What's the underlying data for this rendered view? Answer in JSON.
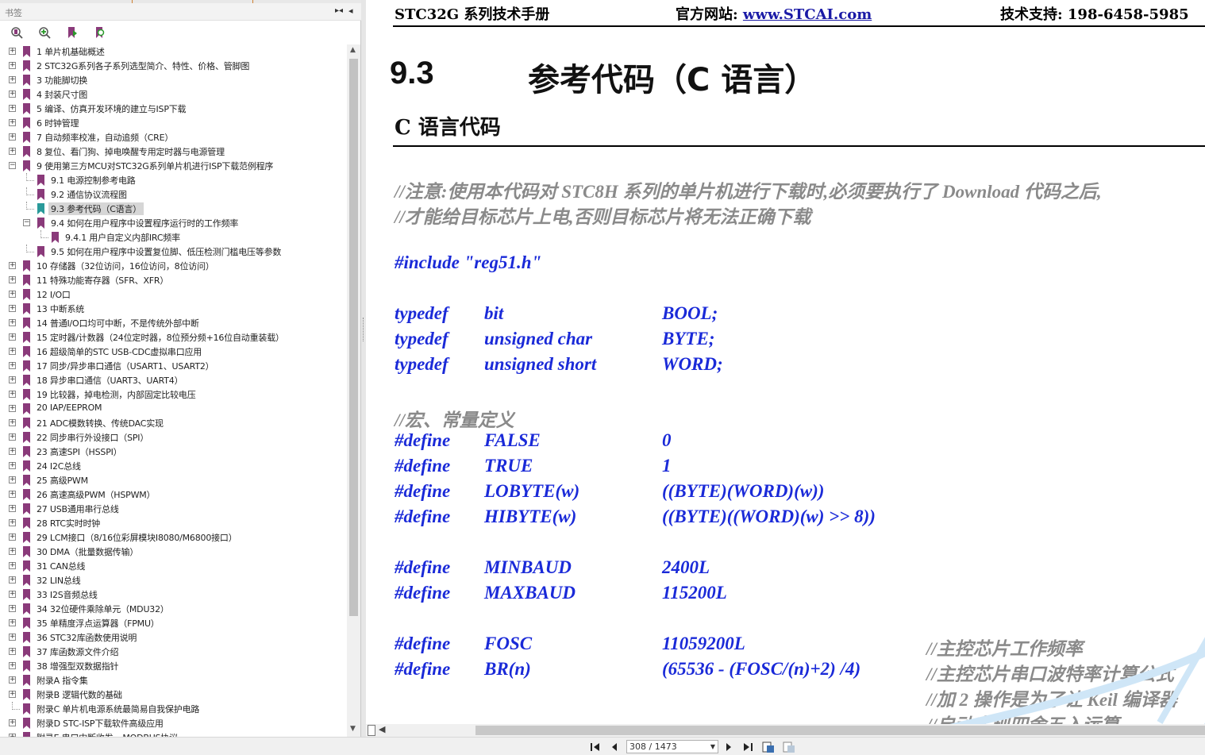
{
  "sidebar": {
    "title": "书签",
    "collapse_icon": "▸◂",
    "close_icon": "◂",
    "toolbar": [
      "expand-bookmark-icon",
      "add-bookmark-icon",
      "bookmark-up-icon",
      "bookmark-search-icon"
    ],
    "items": [
      {
        "label": "1 单片机基础概述",
        "level": 0,
        "expandable": true
      },
      {
        "label": "2  STC32G系列各子系列选型简介、特性、价格、管脚图",
        "level": 0,
        "expandable": true
      },
      {
        "label": "3  功能脚切换",
        "level": 0,
        "expandable": true
      },
      {
        "label": "4  封装尺寸图",
        "level": 0,
        "expandable": true
      },
      {
        "label": "5  编译、仿真开发环境的建立与ISP下载",
        "level": 0,
        "expandable": true
      },
      {
        "label": "6  时钟管理",
        "level": 0,
        "expandable": true
      },
      {
        "label": "7  自动频率校准，自动追频（CRE）",
        "level": 0,
        "expandable": true
      },
      {
        "label": "8  复位、看门狗、掉电唤醒专用定时器与电源管理",
        "level": 0,
        "expandable": true
      },
      {
        "label": "9  使用第三方MCU对STC32G系列单片机进行ISP下载范例程序",
        "level": 0,
        "expandable": true,
        "expanded": true
      },
      {
        "label": "9.1 电源控制参考电路",
        "level": 1,
        "expandable": false
      },
      {
        "label": "9.2  通信协议流程图",
        "level": 1,
        "expandable": false
      },
      {
        "label": "9.3  参考代码（C语言）",
        "level": 1,
        "expandable": false,
        "selected": true
      },
      {
        "label": "9.4  如何在用户程序中设置程序运行时的工作频率",
        "level": 1,
        "expandable": true,
        "expanded": true
      },
      {
        "label": "9.4.1 用户自定义内部IRC频率",
        "level": 2,
        "expandable": false
      },
      {
        "label": "9.5  如何在用户程序中设置复位脚、低压检测门槛电压等参数",
        "level": 1,
        "expandable": false
      },
      {
        "label": "10  存储器（32位访问，16位访问，8位访问）",
        "level": 0,
        "expandable": true
      },
      {
        "label": "11  特殊功能寄存器（SFR、XFR）",
        "level": 0,
        "expandable": true
      },
      {
        "label": "12  I/O口",
        "level": 0,
        "expandable": true
      },
      {
        "label": "13  中断系统",
        "level": 0,
        "expandable": true
      },
      {
        "label": "14  普通I/O口均可中断，不是传统外部中断",
        "level": 0,
        "expandable": true
      },
      {
        "label": "15  定时器/计数器（24位定时器，8位预分频+16位自动重装载）",
        "level": 0,
        "expandable": true
      },
      {
        "label": "16  超级简单的STC USB-CDC虚拟串口应用",
        "level": 0,
        "expandable": true
      },
      {
        "label": "17  同步/异步串口通信（USART1、USART2）",
        "level": 0,
        "expandable": true
      },
      {
        "label": "18  异步串口通信（UART3、UART4）",
        "level": 0,
        "expandable": true
      },
      {
        "label": "19  比较器，掉电检测，内部固定比较电压",
        "level": 0,
        "expandable": true
      },
      {
        "label": "20  IAP/EEPROM",
        "level": 0,
        "expandable": true
      },
      {
        "label": "21  ADC模数转换、传统DAC实现",
        "level": 0,
        "expandable": true
      },
      {
        "label": "22  同步串行外设接口（SPI）",
        "level": 0,
        "expandable": true
      },
      {
        "label": "23  高速SPI（HSSPI）",
        "level": 0,
        "expandable": true
      },
      {
        "label": "24  I2C总线",
        "level": 0,
        "expandable": true
      },
      {
        "label": "25  高级PWM",
        "level": 0,
        "expandable": true
      },
      {
        "label": "26  高速高级PWM（HSPWM）",
        "level": 0,
        "expandable": true
      },
      {
        "label": "27  USB通用串行总线",
        "level": 0,
        "expandable": true
      },
      {
        "label": "28  RTC实时时钟",
        "level": 0,
        "expandable": true
      },
      {
        "label": "29  LCM接口（8/16位彩屏模块I8080/M6800接口）",
        "level": 0,
        "expandable": true
      },
      {
        "label": "30  DMA（批量数据传输）",
        "level": 0,
        "expandable": true
      },
      {
        "label": "31  CAN总线",
        "level": 0,
        "expandable": true
      },
      {
        "label": "32  LIN总线",
        "level": 0,
        "expandable": true
      },
      {
        "label": "33  I2S音频总线",
        "level": 0,
        "expandable": true
      },
      {
        "label": "34  32位硬件乘除单元（MDU32）",
        "level": 0,
        "expandable": true
      },
      {
        "label": "35  单精度浮点运算器（FPMU）",
        "level": 0,
        "expandable": true
      },
      {
        "label": "36  STC32库函数使用说明",
        "level": 0,
        "expandable": true
      },
      {
        "label": "37  库函数源文件介绍",
        "level": 0,
        "expandable": true
      },
      {
        "label": "38  增强型双数据指针",
        "level": 0,
        "expandable": true
      },
      {
        "label": "附录A  指令集",
        "level": 0,
        "expandable": true
      },
      {
        "label": "附录B  逻辑代数的基础",
        "level": 0,
        "expandable": true
      },
      {
        "label": "附录C  单片机电源系统最简易自我保护电路",
        "level": 0,
        "expandable": false
      },
      {
        "label": "附录D  STC-ISP下载软件高级应用",
        "level": 0,
        "expandable": true
      },
      {
        "label": "附录E  串口中断收发 – MODBUS协议",
        "level": 0,
        "expandable": true
      }
    ]
  },
  "document": {
    "header_left": "STC32G 系列技术手册",
    "header_mid_label": "官方网站: ",
    "header_mid_link": "www.STCAI.com",
    "header_right": "技术支持: 198-6458-5985",
    "section_number": "9.3",
    "section_title": "参考代码（C 语言）",
    "subtitle": "C 语言代码",
    "lines": [
      {
        "cols": [
          {
            "text": "//注意:使用本代码对 STC8H 系列的单片机进行下载时,必须要执行了 Download 代码之后,",
            "kind": "comment"
          }
        ]
      },
      {
        "cols": [
          {
            "text": "//才能给目标芯片上电,否则目标芯片将无法正确下载",
            "kind": "comment"
          }
        ]
      },
      {
        "cols": [
          {
            "text": "#include \"reg51.h\"",
            "kind": "kw"
          }
        ]
      },
      {
        "cols": [
          {
            "text": "typedef",
            "kind": "kw"
          },
          {
            "text": "bit",
            "kind": "kw"
          },
          {
            "text": "BOOL;",
            "kind": "kw"
          }
        ]
      },
      {
        "cols": [
          {
            "text": "typedef",
            "kind": "kw"
          },
          {
            "text": "unsigned char",
            "kind": "kw"
          },
          {
            "text": "BYTE;",
            "kind": "kw"
          }
        ]
      },
      {
        "cols": [
          {
            "text": "typedef",
            "kind": "kw"
          },
          {
            "text": "unsigned short",
            "kind": "kw"
          },
          {
            "text": "WORD;",
            "kind": "kw"
          }
        ]
      },
      {
        "cols": [
          {
            "text": "//宏、常量定义",
            "kind": "comment"
          }
        ]
      },
      {
        "cols": [
          {
            "text": "#define",
            "kind": "kw"
          },
          {
            "text": "FALSE",
            "kind": "kw"
          },
          {
            "text": "0",
            "kind": "kw"
          }
        ]
      },
      {
        "cols": [
          {
            "text": "#define",
            "kind": "kw"
          },
          {
            "text": "TRUE",
            "kind": "kw"
          },
          {
            "text": "1",
            "kind": "kw"
          }
        ]
      },
      {
        "cols": [
          {
            "text": "#define",
            "kind": "kw"
          },
          {
            "text": "LOBYTE(w)",
            "kind": "kw"
          },
          {
            "text": "((BYTE)(WORD)(w))",
            "kind": "kw"
          }
        ]
      },
      {
        "cols": [
          {
            "text": "#define",
            "kind": "kw"
          },
          {
            "text": "HIBYTE(w)",
            "kind": "kw"
          },
          {
            "text": "((BYTE)((WORD)(w) >> 8))",
            "kind": "kw"
          }
        ]
      },
      {
        "cols": [
          {
            "text": "#define",
            "kind": "kw"
          },
          {
            "text": "MINBAUD",
            "kind": "kw"
          },
          {
            "text": "2400L",
            "kind": "kw"
          }
        ]
      },
      {
        "cols": [
          {
            "text": "#define",
            "kind": "kw"
          },
          {
            "text": "MAXBAUD",
            "kind": "kw"
          },
          {
            "text": "115200L",
            "kind": "kw"
          }
        ]
      },
      {
        "cols": [
          {
            "text": "#define",
            "kind": "kw"
          },
          {
            "text": "FOSC",
            "kind": "kw"
          },
          {
            "text": "11059200L",
            "kind": "kw"
          },
          {
            "text": "//主控芯片工作频率",
            "kind": "comment"
          }
        ]
      },
      {
        "cols": [
          {
            "text": "#define",
            "kind": "kw"
          },
          {
            "text": "BR(n)",
            "kind": "kw"
          },
          {
            "text": "(65536 - (FOSC/(n)+2) /4)",
            "kind": "kw"
          },
          {
            "text": "//主控芯片串口波特率计算公式",
            "kind": "comment"
          }
        ]
      },
      {
        "cols": [
          {
            "text": "//加 2 操作是为了让 Keil 编译器",
            "kind": "comment"
          }
        ]
      },
      {
        "cols": [
          {
            "text": "//自动实现四舍五入运算",
            "kind": "comment"
          }
        ]
      }
    ],
    "watermark_color": "#cfe6f7"
  },
  "statusbar": {
    "page_display": "308 / 1473",
    "buttons": [
      "first-page-icon",
      "prev-page-icon",
      "next-page-icon",
      "last-page-icon",
      "fit-page-icon",
      "fit-width-icon"
    ]
  },
  "colors": {
    "keyword": "#1a2ad8",
    "comment": "#8a8a8a",
    "bookmark": "#8a3a7a",
    "bookmark_active": "#2a9a9a"
  }
}
